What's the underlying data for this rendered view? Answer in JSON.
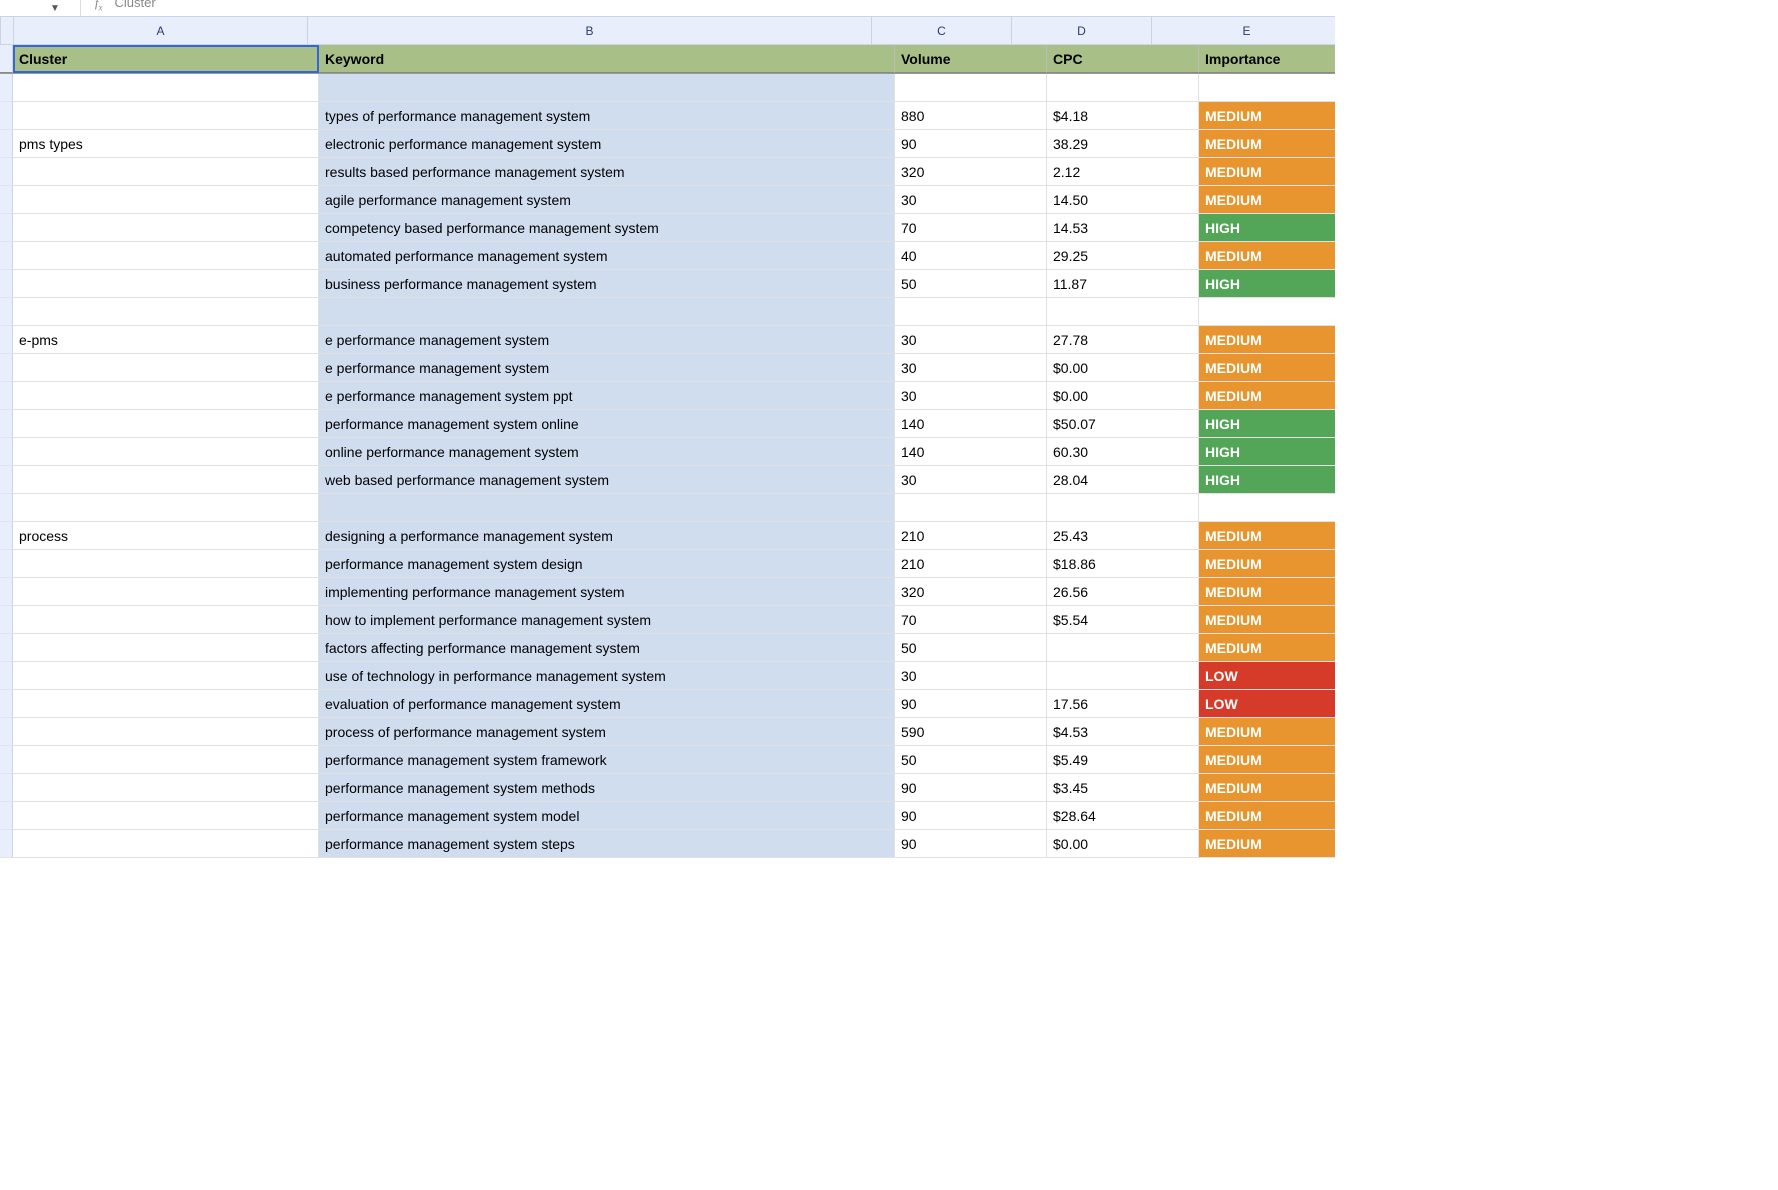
{
  "formula_bar": {
    "value": "Cluster"
  },
  "columns": {
    "A": "A",
    "B": "B",
    "C": "C",
    "D": "D",
    "E": "E"
  },
  "header": {
    "A": "Cluster",
    "B": "Keyword",
    "C": "Volume",
    "D": "CPC",
    "E": "Importance"
  },
  "rows": [
    {
      "A": "",
      "B": "",
      "C": "",
      "D": "",
      "E": "",
      "impClass": ""
    },
    {
      "A": "",
      "B": "types of performance management system",
      "C": "880",
      "D": "$4.18",
      "E": "MEDIUM",
      "impClass": "MEDIUM"
    },
    {
      "A": "pms types",
      "B": "electronic performance management system",
      "C": "90",
      "D": "38.29",
      "E": "MEDIUM",
      "impClass": "MEDIUM"
    },
    {
      "A": "",
      "B": "results based performance management system",
      "C": "320",
      "D": "2.12",
      "E": "MEDIUM",
      "impClass": "MEDIUM"
    },
    {
      "A": "",
      "B": "agile performance management system",
      "C": "30",
      "D": "14.50",
      "E": "MEDIUM",
      "impClass": "MEDIUM"
    },
    {
      "A": "",
      "B": "competency based performance management system",
      "C": "70",
      "D": "14.53",
      "E": "HIGH",
      "impClass": "HIGH"
    },
    {
      "A": "",
      "B": "automated performance management system",
      "C": "40",
      "D": "29.25",
      "E": "MEDIUM",
      "impClass": "MEDIUM"
    },
    {
      "A": "",
      "B": "business performance management system",
      "C": "50",
      "D": "11.87",
      "E": "HIGH",
      "impClass": "HIGH"
    },
    {
      "A": "",
      "B": "",
      "C": "",
      "D": "",
      "E": "",
      "impClass": ""
    },
    {
      "A": "e-pms",
      "B": "e performance management system",
      "C": "30",
      "D": "27.78",
      "E": "MEDIUM",
      "impClass": "MEDIUM"
    },
    {
      "A": "",
      "B": "e performance management system",
      "C": "30",
      "D": "$0.00",
      "E": "MEDIUM",
      "impClass": "MEDIUM"
    },
    {
      "A": "",
      "B": "e performance management system ppt",
      "C": "30",
      "D": "$0.00",
      "E": "MEDIUM",
      "impClass": "MEDIUM"
    },
    {
      "A": "",
      "B": "performance management system online",
      "C": "140",
      "D": "$50.07",
      "E": "HIGH",
      "impClass": "HIGH"
    },
    {
      "A": "",
      "B": "online performance management system",
      "C": "140",
      "D": "60.30",
      "E": "HIGH",
      "impClass": "HIGH"
    },
    {
      "A": "",
      "B": "web based performance management system",
      "C": "30",
      "D": "28.04",
      "E": "HIGH",
      "impClass": "HIGH"
    },
    {
      "A": "",
      "B": "",
      "C": "",
      "D": "",
      "E": "",
      "impClass": ""
    },
    {
      "A": "process",
      "B": "designing a performance management system",
      "C": "210",
      "D": "25.43",
      "E": "MEDIUM",
      "impClass": "MEDIUM"
    },
    {
      "A": "",
      "B": "performance management system design",
      "C": "210",
      "D": "$18.86",
      "E": "MEDIUM",
      "impClass": "MEDIUM"
    },
    {
      "A": "",
      "B": "implementing performance management system",
      "C": "320",
      "D": "26.56",
      "E": "MEDIUM",
      "impClass": "MEDIUM"
    },
    {
      "A": "",
      "B": "how to implement performance management system",
      "C": "70",
      "D": "$5.54",
      "E": "MEDIUM",
      "impClass": "MEDIUM"
    },
    {
      "A": "",
      "B": "factors affecting performance management system",
      "C": "50",
      "D": "",
      "E": "MEDIUM",
      "impClass": "MEDIUM"
    },
    {
      "A": "",
      "B": "use of technology in performance management system",
      "C": "30",
      "D": "",
      "E": "LOW",
      "impClass": "LOW"
    },
    {
      "A": "",
      "B": "evaluation of performance management system",
      "C": "90",
      "D": "17.56",
      "E": "LOW",
      "impClass": "LOW"
    },
    {
      "A": "",
      "B": "process of performance management system",
      "C": "590",
      "D": "$4.53",
      "E": "MEDIUM",
      "impClass": "MEDIUM"
    },
    {
      "A": "",
      "B": "performance management system framework",
      "C": "50",
      "D": "$5.49",
      "E": "MEDIUM",
      "impClass": "MEDIUM"
    },
    {
      "A": "",
      "B": "performance management system methods",
      "C": "90",
      "D": "$3.45",
      "E": "MEDIUM",
      "impClass": "MEDIUM"
    },
    {
      "A": "",
      "B": "performance management system model",
      "C": "90",
      "D": "$28.64",
      "E": "MEDIUM",
      "impClass": "MEDIUM"
    },
    {
      "A": "",
      "B": "performance management system steps",
      "C": "90",
      "D": "$0.00",
      "E": "MEDIUM",
      "impClass": "MEDIUM"
    }
  ]
}
